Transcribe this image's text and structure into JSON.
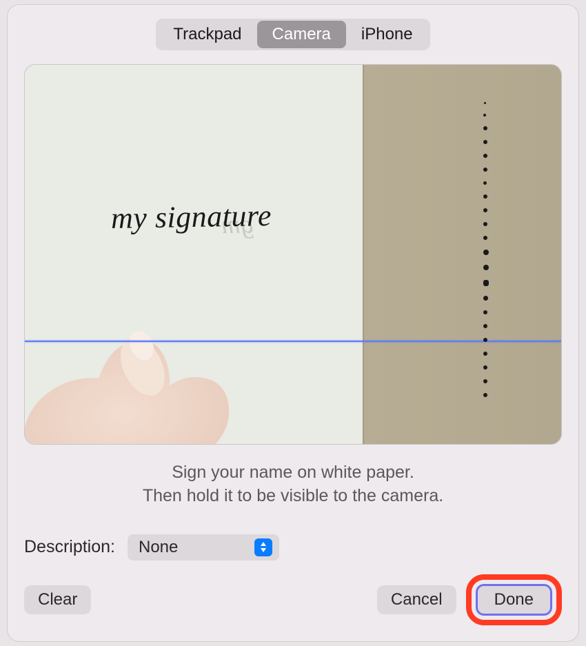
{
  "tabs": {
    "trackpad": "Trackpad",
    "camera": "Camera",
    "iphone": "iPhone",
    "active": "camera"
  },
  "preview": {
    "signature_text": "my signature"
  },
  "instructions": {
    "line1": "Sign your name on white paper.",
    "line2": "Then hold it to be visible to the camera."
  },
  "description": {
    "label": "Description:",
    "value": "None"
  },
  "buttons": {
    "clear": "Clear",
    "cancel": "Cancel",
    "done": "Done"
  }
}
